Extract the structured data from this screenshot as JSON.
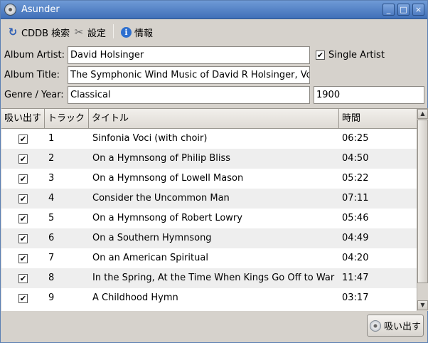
{
  "window": {
    "title": "Asunder",
    "controls": [
      "_",
      "□",
      "×"
    ]
  },
  "toolbar": {
    "cddb_label": "CDDB 検索",
    "prefs_label": "設定",
    "about_label": "情報",
    "icons": [
      "refresh-icon",
      "tools-icon",
      "info-icon"
    ]
  },
  "form": {
    "album_artist_label": "Album Artist:",
    "album_artist_value": "David Holsinger",
    "single_artist_label": "Single Artist",
    "single_artist_checked": true,
    "album_title_label": "Album Title:",
    "album_title_value": "The Symphonic Wind Music of David R Holsinger, Vol",
    "genre_year_label": "Genre / Year:",
    "genre_value": "Classical",
    "year_value": "1900"
  },
  "tracklist": {
    "columns": {
      "rip": "吸い出す",
      "track": "トラック",
      "title": "タイトル",
      "time": "時間"
    },
    "rows": [
      {
        "rip": true,
        "track": "1",
        "title": "Sinfonia Voci (with choir)",
        "time": "06:25"
      },
      {
        "rip": true,
        "track": "2",
        "title": "On a Hymnsong of Philip Bliss",
        "time": "04:50"
      },
      {
        "rip": true,
        "track": "3",
        "title": "On a Hymnsong of Lowell Mason",
        "time": "05:22"
      },
      {
        "rip": true,
        "track": "4",
        "title": "Consider the Uncommon Man",
        "time": "07:11"
      },
      {
        "rip": true,
        "track": "5",
        "title": "On a Hymnsong of Robert Lowry",
        "time": "05:46"
      },
      {
        "rip": true,
        "track": "6",
        "title": "On a Southern Hymnsong",
        "time": "04:49"
      },
      {
        "rip": true,
        "track": "7",
        "title": "On an American Spiritual",
        "time": "04:20"
      },
      {
        "rip": true,
        "track": "8",
        "title": "In the Spring, At the Time When Kings Go Off to War",
        "time": "11:47"
      },
      {
        "rip": true,
        "track": "9",
        "title": "A Childhood Hymn",
        "time": "03:17"
      }
    ]
  },
  "actions": {
    "rip_label": "吸い出す"
  },
  "colors": {
    "titlebar": "#4f7fc4",
    "window_bg": "#d6d2cc",
    "row_alt": "#eeeeee"
  }
}
